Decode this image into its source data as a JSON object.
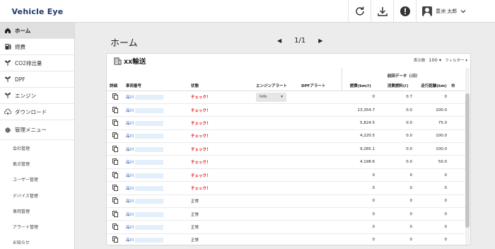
{
  "app": {
    "logo": "Vehicle Eye"
  },
  "header": {
    "icons": [
      "refresh-icon",
      "download-icon",
      "alert-icon"
    ],
    "user_name": "豊洲 太郎"
  },
  "sidebar": {
    "items": [
      {
        "label": "ホーム",
        "icon": "home-icon"
      },
      {
        "label": "燃費",
        "icon": "fuel-icon"
      },
      {
        "label": "CO2排出量",
        "icon": "co2-icon"
      },
      {
        "label": "DPF",
        "icon": "dpf-icon"
      },
      {
        "label": "エンジン",
        "icon": "engine-icon"
      },
      {
        "label": "ダウンロード",
        "icon": "download-cloud-icon"
      }
    ],
    "admin": {
      "label": "管理メニュー",
      "icon": "gear-icon",
      "items": [
        "会社管理",
        "拠点管理",
        "ユーザー管理",
        "デバイス管理",
        "車両管理",
        "アラート管理",
        "お知らせ"
      ]
    }
  },
  "main": {
    "title": "ホーム",
    "pager": {
      "current": "1/1"
    }
  },
  "card": {
    "title": "xx輸送",
    "icon": "building-icon",
    "per_page_label": "表示数",
    "per_page_value": "100",
    "filter_label": "フィルター"
  },
  "table": {
    "group_header": "前回データ（/日）",
    "columns": {
      "detail": "詳細",
      "vehicle": "車両番号",
      "status": "状態",
      "engine_alert": "エンジンアラート",
      "dpf_alert": "DPFアラート",
      "fuel_eff": "燃費(km/ℓ)",
      "fuel_used": "消費燃料(ℓ)",
      "distance": "走行距離(km)",
      "extra": "市"
    },
    "rows": [
      {
        "vehicle": "品川",
        "status": "チェック！",
        "status_type": "warn",
        "engine_alert": "Info",
        "fuel_eff": "0",
        "fuel_used": "0.7",
        "distance": "0"
      },
      {
        "vehicle": "品川",
        "status": "チェック！",
        "status_type": "warn",
        "engine_alert": "",
        "fuel_eff": "13,354.7",
        "fuel_used": "0.0",
        "distance": "100.0"
      },
      {
        "vehicle": "品川",
        "status": "チェック！",
        "status_type": "warn",
        "engine_alert": "",
        "fuel_eff": "5,824.5",
        "fuel_used": "0.0",
        "distance": "75.0"
      },
      {
        "vehicle": "品川",
        "status": "チェック！",
        "status_type": "warn",
        "engine_alert": "",
        "fuel_eff": "4,220.5",
        "fuel_used": "0.0",
        "distance": "100.0"
      },
      {
        "vehicle": "品川",
        "status": "チェック！",
        "status_type": "warn",
        "engine_alert": "",
        "fuel_eff": "9,285.1",
        "fuel_used": "0.0",
        "distance": "100.0"
      },
      {
        "vehicle": "品川",
        "status": "チェック！",
        "status_type": "warn",
        "engine_alert": "",
        "fuel_eff": "4,198.6",
        "fuel_used": "0.0",
        "distance": "50.0"
      },
      {
        "vehicle": "品川",
        "status": "チェック！",
        "status_type": "warn",
        "engine_alert": "",
        "fuel_eff": "0",
        "fuel_used": "0",
        "distance": "0"
      },
      {
        "vehicle": "品川",
        "status": "チェック！",
        "status_type": "warn",
        "engine_alert": "",
        "fuel_eff": "0",
        "fuel_used": "0",
        "distance": "0"
      },
      {
        "vehicle": "品川",
        "status": "正常",
        "status_type": "ok",
        "engine_alert": "",
        "fuel_eff": "0",
        "fuel_used": "0",
        "distance": "0"
      },
      {
        "vehicle": "品川",
        "status": "正常",
        "status_type": "ok",
        "engine_alert": "",
        "fuel_eff": "0",
        "fuel_used": "0",
        "distance": "0"
      },
      {
        "vehicle": "品川",
        "status": "正常",
        "status_type": "ok",
        "engine_alert": "",
        "fuel_eff": "0",
        "fuel_used": "0",
        "distance": "0"
      },
      {
        "vehicle": "品川",
        "status": "正常",
        "status_type": "ok",
        "engine_alert": "",
        "fuel_eff": "0",
        "fuel_used": "0",
        "distance": "0"
      }
    ]
  },
  "colors": {
    "warn": "#d11111",
    "link": "#1a56b0",
    "logo": "#1f3a6e"
  }
}
